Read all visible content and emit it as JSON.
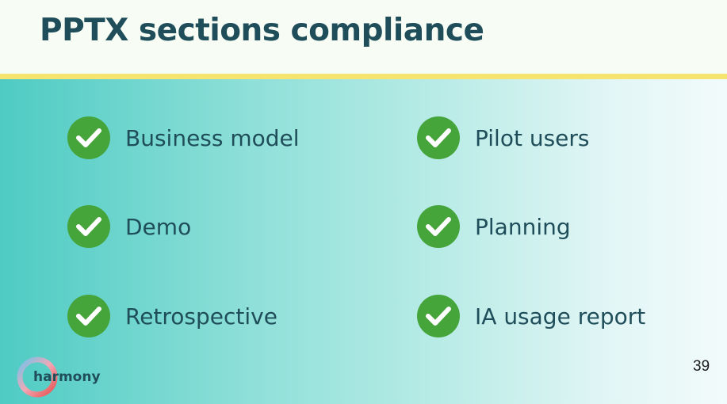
{
  "slide": {
    "title": "PPTX sections compliance",
    "items": [
      {
        "label": "Business model",
        "status_icon": "check-circle-icon"
      },
      {
        "label": "Pilot users",
        "status_icon": "check-circle-icon"
      },
      {
        "label": "Demo",
        "status_icon": "check-circle-icon"
      },
      {
        "label": "Planning",
        "status_icon": "check-circle-icon"
      },
      {
        "label": "Retrospective",
        "status_icon": "check-circle-icon"
      },
      {
        "label": "IA usage report",
        "status_icon": "check-circle-icon"
      }
    ],
    "page_number": "39",
    "logo_text": "harmony"
  },
  "colors": {
    "title": "#1f4e5a",
    "accent_bar": "#f5e46f",
    "check_fill": "#46a53a",
    "gradient_start": "#4ecbc3",
    "gradient_end": "#f2fbfb"
  }
}
